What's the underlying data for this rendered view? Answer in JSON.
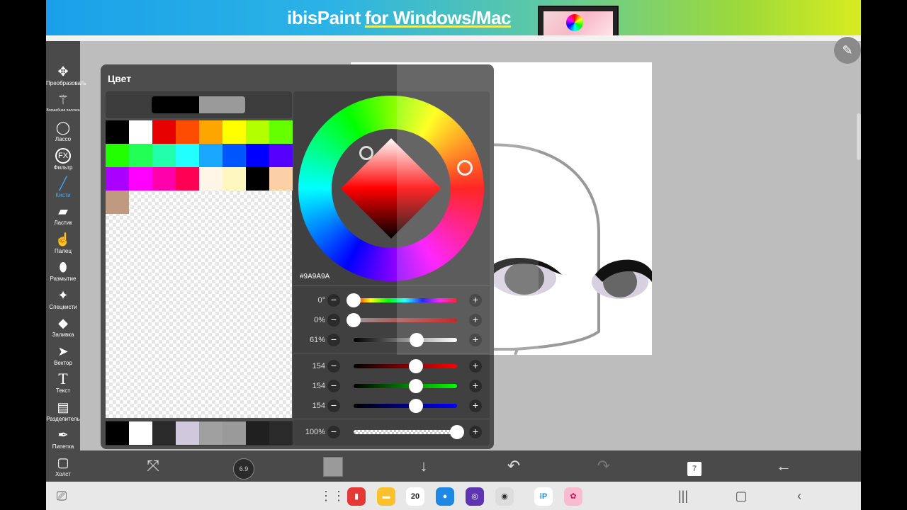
{
  "banner": {
    "brand": "ibisPaint",
    "tagline": "for Windows/Mac"
  },
  "tools": [
    {
      "label": "Преобразовать",
      "icon": "move-icon",
      "glyph": "✥"
    },
    {
      "label": "Волшебная палочка",
      "icon": "magic-wand-icon",
      "glyph": "⟋"
    },
    {
      "label": "Лассо",
      "icon": "lasso-icon",
      "glyph": "◯"
    },
    {
      "label": "Фильтр",
      "icon": "fx-icon",
      "glyph": "FX"
    },
    {
      "label": "Кисти",
      "icon": "brush-icon",
      "glyph": "╱"
    },
    {
      "label": "Ластик",
      "icon": "eraser-icon",
      "glyph": "▰"
    },
    {
      "label": "Палец",
      "icon": "smudge-icon",
      "glyph": "☝"
    },
    {
      "label": "Размытие",
      "icon": "blur-icon",
      "glyph": "💧"
    },
    {
      "label": "Спецкисти",
      "icon": "special-brush-icon",
      "glyph": "✦"
    },
    {
      "label": "Заливка",
      "icon": "fill-icon",
      "glyph": "◆"
    },
    {
      "label": "Вектор",
      "icon": "vector-icon",
      "glyph": "➤"
    },
    {
      "label": "Текст",
      "icon": "text-icon",
      "glyph": "T"
    },
    {
      "label": "Разделитель",
      "icon": "frame-divider-icon",
      "glyph": "▤"
    },
    {
      "label": "Пипетка",
      "icon": "eyedropper-icon",
      "glyph": "✒"
    },
    {
      "label": "Холст",
      "icon": "canvas-icon",
      "glyph": "▢"
    }
  ],
  "active_tool": "Кисти",
  "color_panel": {
    "title": "Цвет",
    "foreground": "#000000",
    "background": "#9A9A9A",
    "palette": [
      "#000000",
      "#ffffff",
      "#e60000",
      "#ff4d00",
      "#ffa500",
      "#ffff00",
      "#b3ff00",
      "#66ff00",
      "#22ff00",
      "#22ff55",
      "#22ffaa",
      "#22ffff",
      "#1aa8ff",
      "#0055ff",
      "#0000ff",
      "#5500ff",
      "#aa00ff",
      "#ff00ff",
      "#ff00aa",
      "#ff0055",
      "#fff6e8",
      "#fff6c0",
      "#000000",
      "#fbd0a8",
      "#c09a80"
    ],
    "recent": [
      "#000000",
      "#ffffff",
      "#2a2a2a",
      "#d0c8dc",
      "#a0a0a0",
      "#9a9a9a",
      "#202020",
      "#2a2a2a"
    ],
    "hex": "#9A9A9A",
    "hsb": [
      {
        "label": "0°",
        "kind": "hue",
        "value": 0
      },
      {
        "label": "0%",
        "kind": "saturation",
        "value": 0
      },
      {
        "label": "61%",
        "kind": "brightness",
        "value": 61
      }
    ],
    "rgb": [
      {
        "label": "154",
        "kind": "red",
        "value": 154
      },
      {
        "label": "154",
        "kind": "green",
        "value": 154
      },
      {
        "label": "154",
        "kind": "blue",
        "value": 154
      }
    ],
    "opacity": {
      "label": "100%",
      "value": 100
    }
  },
  "bottom_bar": {
    "brush_size": "6.9",
    "layer_count": "7"
  },
  "system_dock": {
    "calendar_day": "20"
  }
}
